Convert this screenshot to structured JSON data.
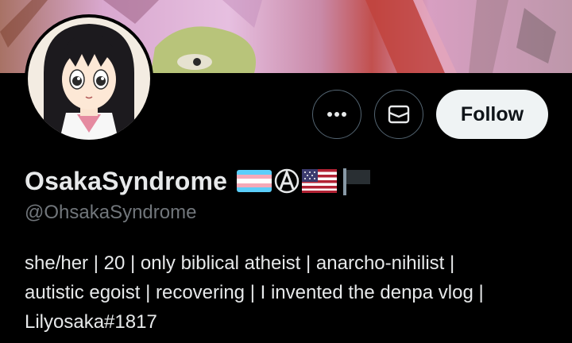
{
  "profile": {
    "display_name": "OsakaSyndrome",
    "handle": "@OhsakaSyndrome",
    "name_emojis": [
      "transgender-flag-icon",
      "circled-a-anarchy-icon",
      "us-flag-icon",
      "black-flag-icon"
    ],
    "bio_lines": [
      "she/her | 20 | only biblical atheist | anarcho-nihilist |",
      "autistic egoist | recovering | I invented the denpa vlog |",
      "Lilyosaka#1817"
    ]
  },
  "actions": {
    "more_icon": "more-horizontal-icon",
    "message_icon": "envelope-icon",
    "follow_label": "Follow"
  },
  "colors": {
    "background": "#000000",
    "text": "#e7e9ea",
    "secondary_text": "#71767b",
    "button_border": "#536471",
    "follow_bg": "#eff3f4"
  }
}
